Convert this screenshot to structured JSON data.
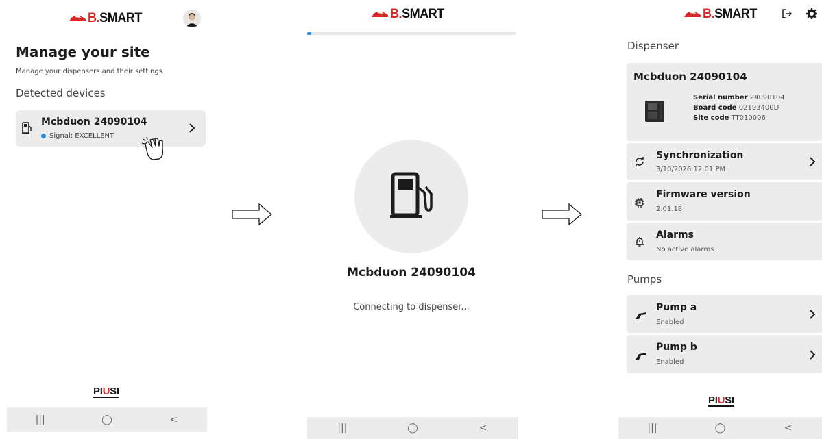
{
  "brand": {
    "logo_b": "B.",
    "logo_rest": "SMART"
  },
  "footer_brand": {
    "pi": "PI",
    "u": "U",
    "si": "SI"
  },
  "navbar": {
    "recent": "|||",
    "home": "◯",
    "back": "<"
  },
  "screen1": {
    "title": "Manage your site",
    "subtitle": "Manage your dispensers and their settings",
    "detected_label": "Detected devices",
    "device": {
      "name": "Mcbduon 24090104",
      "signal": "Signal: EXCELLENT"
    }
  },
  "screen2": {
    "progress": 0.02,
    "name": "Mcbduon 24090104",
    "status": "Connecting to dispenser..."
  },
  "screen3": {
    "dispenser_label": "Dispenser",
    "dispenser": {
      "name": "Mcbduon 24090104",
      "serial_label": "Serial number",
      "serial": "24090104",
      "board_label": "Board code",
      "board": "02193400D",
      "site_label": "Site code",
      "site": "TT010006"
    },
    "sync": {
      "title": "Synchronization",
      "sub": "3/10/2026 12:01 PM"
    },
    "firmware": {
      "title": "Firmware version",
      "sub": "2.01.18"
    },
    "alarms": {
      "title": "Alarms",
      "sub": "No active alarms"
    },
    "pumps_label": "Pumps",
    "pumps": [
      {
        "title": "Pump a",
        "sub": "Enabled"
      },
      {
        "title": "Pump b",
        "sub": "Enabled"
      }
    ]
  },
  "colors": {
    "accent": "#2a8de6",
    "brand_red": "#d9262b",
    "card_bg": "#ececec"
  }
}
